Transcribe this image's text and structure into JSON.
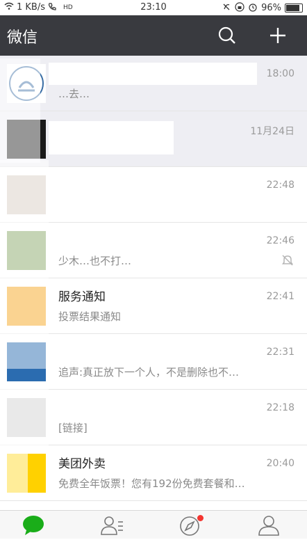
{
  "status_bar": {
    "speed": "1 KB/s",
    "network": "HD",
    "time": "23:10",
    "battery_percent": "96%",
    "battery_level": 0.96
  },
  "header": {
    "title": "微信",
    "search_icon": "search-icon",
    "add_icon": "plus-icon"
  },
  "chats": [
    {
      "name": "",
      "preview": "…去…",
      "time": "18:00",
      "pinned": true
    },
    {
      "name": "",
      "preview": "",
      "time": "11月24日",
      "pinned": true
    },
    {
      "name": "",
      "preview": "",
      "time": "22:48"
    },
    {
      "name": "",
      "preview": "少木…也不打…",
      "time": "22:46",
      "muted": true
    },
    {
      "name": "服务通知",
      "preview": "投票结果通知",
      "time": "22:41"
    },
    {
      "name": "",
      "preview": "追声:真正放下一个人，不是删除也不…",
      "time": "22:31"
    },
    {
      "name": "",
      "preview": "[链接]",
      "time": "22:18"
    },
    {
      "name": "美团外卖",
      "preview": "免费全年饭票！您有192份免费套餐和…",
      "time": "20:40"
    }
  ],
  "tabs": [
    {
      "name": "chats-tab",
      "icon": "chat-bubble-icon",
      "active": true
    },
    {
      "name": "contacts-tab",
      "icon": "contacts-icon"
    },
    {
      "name": "discover-tab",
      "icon": "compass-icon",
      "badge": true
    },
    {
      "name": "me-tab",
      "icon": "person-icon"
    }
  ],
  "colors": {
    "header_bg": "#393a3f",
    "active_green": "#1aad19",
    "badge_red": "#f43530"
  }
}
